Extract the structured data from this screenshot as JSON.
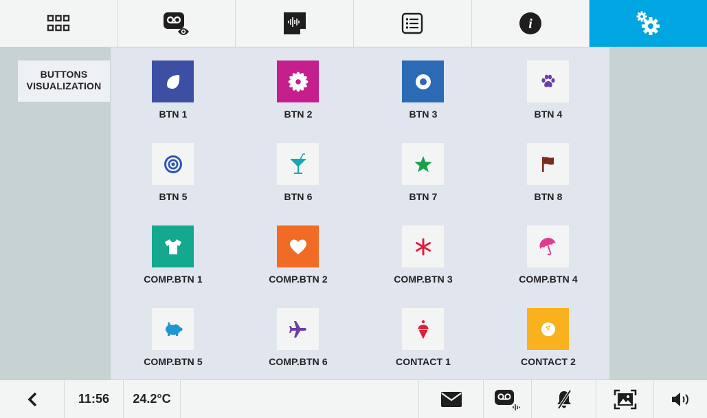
{
  "top_tabs": [
    {
      "name": "apps-grid",
      "icon": "grid-icon"
    },
    {
      "name": "answering-machine-view",
      "icon": "voicemail-eye-icon"
    },
    {
      "name": "audio",
      "icon": "audio-wave-icon"
    },
    {
      "name": "list",
      "icon": "list-icon"
    },
    {
      "name": "info",
      "icon": "info-icon"
    },
    {
      "name": "settings",
      "icon": "settings-gears-icon",
      "active": true
    }
  ],
  "side_label": {
    "line1": "BUTTONS",
    "line2": "VISUALIZATION"
  },
  "buttons": [
    {
      "label": "BTN 1",
      "icon": "leaf-icon",
      "tile_color": "#3d4fa3",
      "icon_color": "#ffffff"
    },
    {
      "label": "BTN 2",
      "icon": "flower-icon",
      "tile_color": "#c41f8d",
      "icon_color": "#ffffff"
    },
    {
      "label": "BTN 3",
      "icon": "circle-icon",
      "tile_color": "#2b6ab5",
      "icon_color": "#ffffff"
    },
    {
      "label": "BTN 4",
      "icon": "paw-icon",
      "tile_color": "#f3f5f5",
      "icon_color": "#6a3ea5"
    },
    {
      "label": "BTN 5",
      "icon": "target-icon",
      "tile_color": "#f3f5f5",
      "icon_color": "#2b55b5"
    },
    {
      "label": "BTN 6",
      "icon": "cocktail-icon",
      "tile_color": "#f3f5f5",
      "icon_color": "#1aa7b5"
    },
    {
      "label": "BTN 7",
      "icon": "star-icon",
      "tile_color": "#f3f5f5",
      "icon_color": "#1aa04a"
    },
    {
      "label": "BTN 8",
      "icon": "flag-icon",
      "tile_color": "#f3f5f5",
      "icon_color": "#7b2a1e"
    },
    {
      "label": "COMP.BTN 1",
      "icon": "tshirt-icon",
      "tile_color": "#14a88e",
      "icon_color": "#ffffff"
    },
    {
      "label": "COMP.BTN 2",
      "icon": "heart-icon",
      "tile_color": "#f26b25",
      "icon_color": "#ffffff"
    },
    {
      "label": "COMP.BTN 3",
      "icon": "asterisk-icon",
      "tile_color": "#f3f5f5",
      "icon_color": "#e0203a"
    },
    {
      "label": "COMP.BTN 4",
      "icon": "umbrella-icon",
      "tile_color": "#f3f5f5",
      "icon_color": "#e03b8f"
    },
    {
      "label": "COMP.BTN 5",
      "icon": "piggy-bank-icon",
      "tile_color": "#f3f5f5",
      "icon_color": "#1e96d2"
    },
    {
      "label": "COMP.BTN 6",
      "icon": "airplane-icon",
      "tile_color": "#f3f5f5",
      "icon_color": "#6a3ea5"
    },
    {
      "label": "CONTACT 1",
      "icon": "ice-cream-icon",
      "tile_color": "#f3f5f5",
      "icon_color": "#e0203a"
    },
    {
      "label": "CONTACT 2",
      "icon": "bowling-ball-icon",
      "tile_color": "#f9b21d",
      "icon_color": "#ffffff"
    }
  ],
  "bottom_bar": {
    "time": "11:56",
    "temperature": "24.2°C"
  }
}
